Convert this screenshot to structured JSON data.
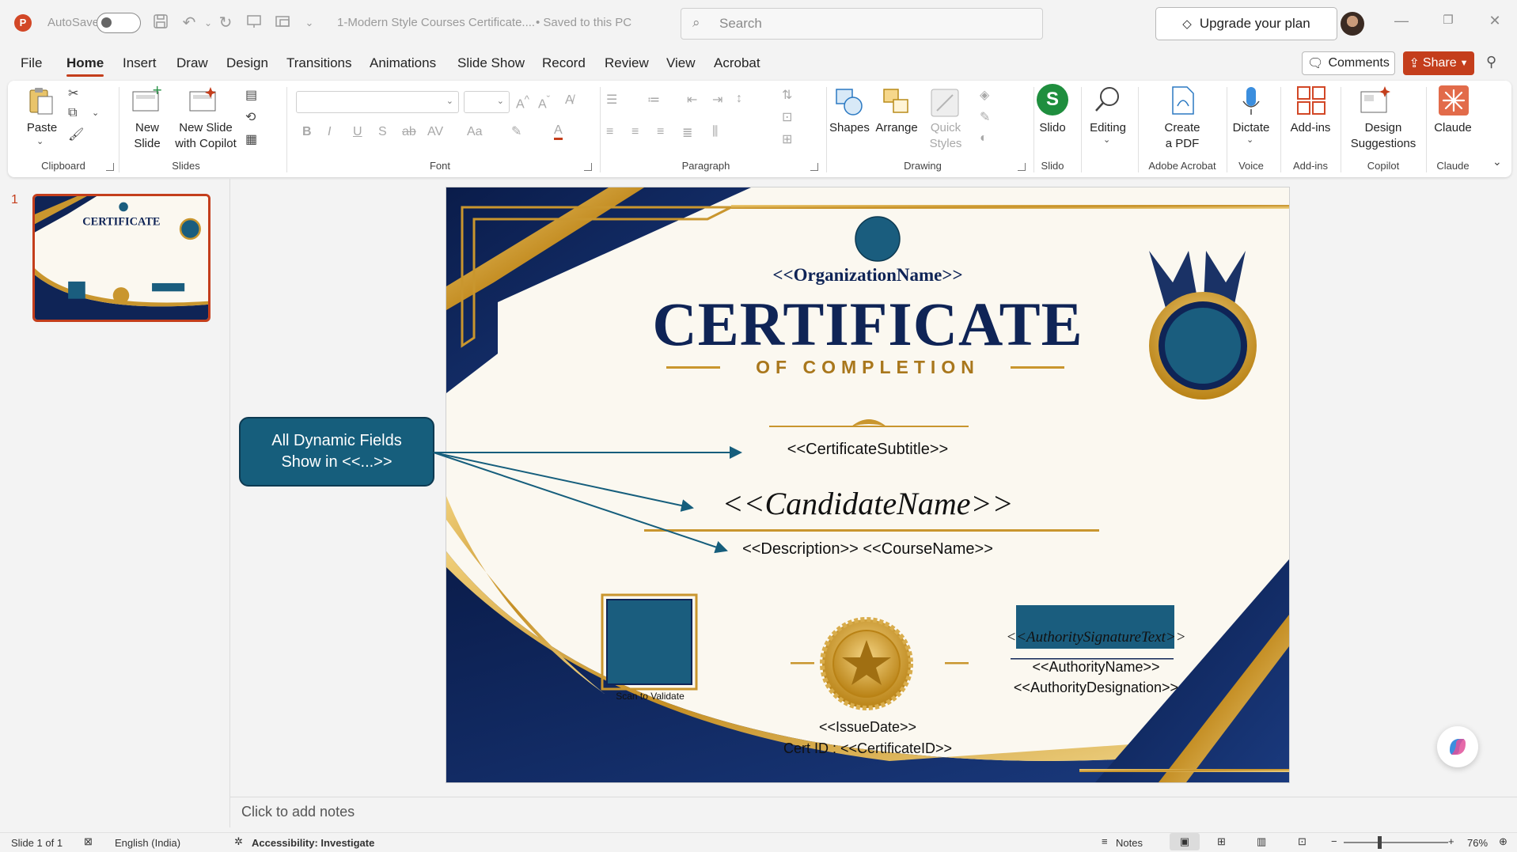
{
  "app": {
    "logo_letter": "P",
    "autosave_label": "AutoSave",
    "doc_title": "1-Modern Style Courses Certificate....",
    "save_status": "• Saved to this PC",
    "search_placeholder": "Search",
    "upgrade_label": "Upgrade your plan",
    "accent": "#c43e1c"
  },
  "menu": {
    "tabs": [
      "File",
      "Home",
      "Insert",
      "Draw",
      "Design",
      "Transitions",
      "Animations",
      "Slide Show",
      "Record",
      "Review",
      "View",
      "Acrobat"
    ],
    "active_tab": "Home",
    "comments_label": "Comments",
    "share_label": "Share"
  },
  "ribbon": {
    "groups": {
      "clipboard": "Clipboard",
      "slides": "Slides",
      "font": "Font",
      "paragraph": "Paragraph",
      "drawing": "Drawing",
      "slido": "Slido",
      "acrobat": "Adobe Acrobat",
      "voice": "Voice",
      "addins": "Add-ins",
      "copilot": "Copilot",
      "claude": "Claude"
    },
    "buttons": {
      "paste": "Paste",
      "new_slide_1": "New",
      "new_slide_2": "Slide",
      "copilot_slide_1": "New Slide",
      "copilot_slide_2": "with Copilot",
      "shapes": "Shapes",
      "arrange": "Arrange",
      "quick_styles_1": "Quick",
      "quick_styles_2": "Styles",
      "slido": "Slido",
      "editing": "Editing",
      "create_pdf_1": "Create",
      "create_pdf_2": "a PDF",
      "dictate": "Dictate",
      "addins": "Add-ins",
      "design_1": "Design",
      "design_2": "Suggestions",
      "claude": "Claude"
    }
  },
  "thumbnails": [
    {
      "number": "1"
    }
  ],
  "slide": {
    "organization": "<<OrganizationName>>",
    "title": "CERTIFICATE",
    "subtitle": "OF COMPLETION",
    "certificate_subtitle": "<<CertificateSubtitle>>",
    "candidate_name": "<<CandidateName>>",
    "description_line": "<<Description>> <<CourseName>>",
    "scan_label": "Scan to Validate",
    "signature_text": "<<AuthoritySignatureText>>",
    "authority_name": "<<AuthorityName>>",
    "authority_designation": "<<AuthorityDesignation>>",
    "issue_date": "<<IssueDate>>",
    "cert_id": "Cert ID :  <<CertificateID>>",
    "colors": {
      "navy": "#0f2456",
      "gold": "#c9962e",
      "teal": "#1a5d7e",
      "paper": "#fbf8f0"
    }
  },
  "callout": {
    "line1": "All Dynamic Fields",
    "line2": "Show in <<...>>"
  },
  "notes": {
    "placeholder": "Click to add notes"
  },
  "status": {
    "slide_count": "Slide 1 of 1",
    "language": "English (India)",
    "accessibility": "Accessibility: Investigate",
    "notes_label": "Notes",
    "zoom": "76%"
  }
}
